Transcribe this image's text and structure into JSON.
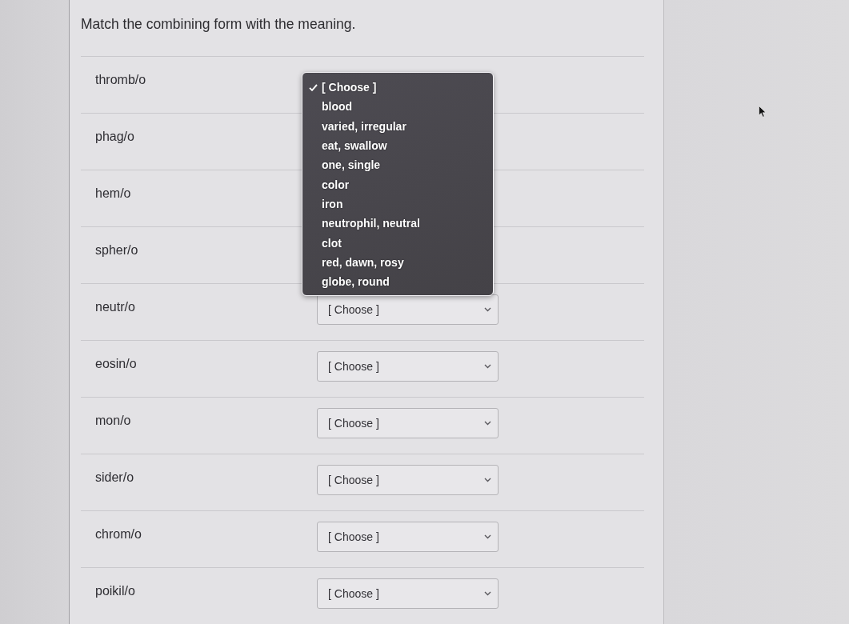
{
  "instruction": "Match the combining form with the meaning.",
  "rows": [
    {
      "term": "thromb/o",
      "menu": {
        "options": [
          {
            "label": "[ Choose ]",
            "selected": true
          },
          {
            "label": "blood",
            "selected": false
          },
          {
            "label": "varied, irregular",
            "selected": false
          },
          {
            "label": "eat, swallow",
            "selected": false
          },
          {
            "label": "one, single",
            "selected": false
          },
          {
            "label": "color",
            "selected": false
          },
          {
            "label": "iron",
            "selected": false
          },
          {
            "label": "neutrophil, neutral",
            "selected": false
          },
          {
            "label": "clot",
            "selected": false
          },
          {
            "label": "red, dawn, rosy",
            "selected": false
          },
          {
            "label": "globe, round",
            "selected": false
          }
        ]
      }
    },
    {
      "term": "phag/o"
    },
    {
      "term": "hem/o"
    },
    {
      "term": "spher/o"
    },
    {
      "term": "neutr/o",
      "value": "[ Choose ]"
    },
    {
      "term": "eosin/o",
      "value": "[ Choose ]"
    },
    {
      "term": "mon/o",
      "value": "[ Choose ]"
    },
    {
      "term": "sider/o",
      "value": "[ Choose ]"
    },
    {
      "term": "chrom/o",
      "value": "[ Choose ]"
    },
    {
      "term": "poikil/o",
      "value": "[ Choose ]"
    }
  ]
}
